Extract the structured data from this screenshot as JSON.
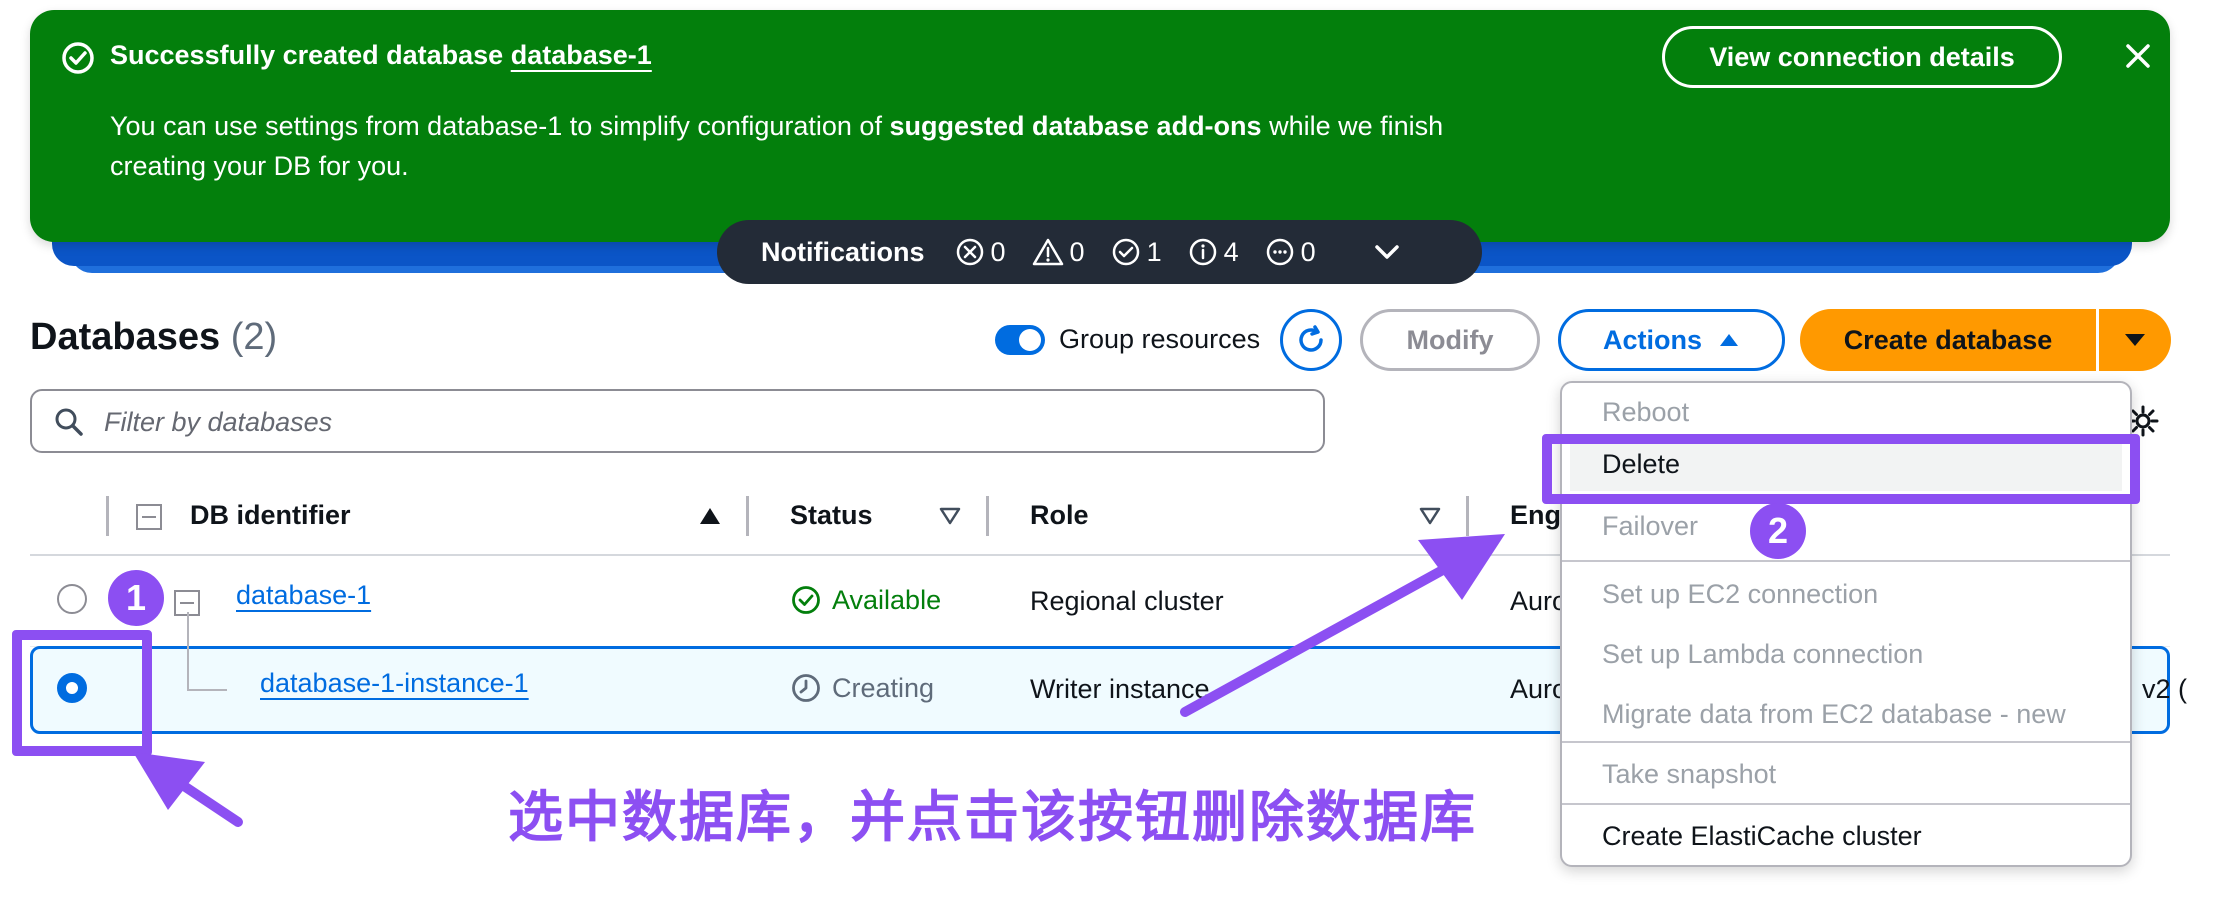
{
  "flash": {
    "title_prefix": "Successfully created database",
    "title_link": "database-1",
    "body_line1_prefix": "You can use settings from database-1 to simplify configuration of",
    "body_bold": "suggested database add-ons",
    "body_line1_suffix": "while we finish",
    "body_line2": "creating your DB for you.",
    "view_button": "View connection details",
    "bg_color": "#037f0c"
  },
  "notifications": {
    "title": "Notifications",
    "errors": "0",
    "warnings": "0",
    "success": "1",
    "info": "4",
    "in_progress": "0"
  },
  "header": {
    "title": "Databases",
    "count": "(2)",
    "group_toggle_label": "Group resources",
    "group_toggle_on": true,
    "modify_label": "Modify",
    "actions_label": "Actions",
    "create_label": "Create database"
  },
  "search": {
    "placeholder": "Filter by databases"
  },
  "table": {
    "columns": [
      "DB identifier",
      "Status",
      "Role",
      "Eng"
    ],
    "rows": [
      {
        "identifier": "database-1",
        "status": "Available",
        "role": "Regional cluster",
        "engine": "Auro",
        "selected": false
      },
      {
        "identifier": "database-1-instance-1",
        "status": "Creating",
        "role": "Writer instance",
        "engine": "Auro",
        "extra": "v2 (",
        "selected": true
      }
    ]
  },
  "actions_menu": {
    "items": [
      {
        "label": "Reboot",
        "enabled": false
      },
      {
        "label": "Delete",
        "enabled": true
      },
      {
        "label": "Failover",
        "enabled": false
      },
      {
        "label": "Set up EC2 connection",
        "enabled": false
      },
      {
        "label": "Set up Lambda connection",
        "enabled": false
      },
      {
        "label": "Migrate data from EC2 database - new",
        "enabled": false
      },
      {
        "label": "Take snapshot",
        "enabled": false
      },
      {
        "label": "Create ElastiCache cluster",
        "enabled": true
      }
    ]
  },
  "annotations": {
    "step1": "1",
    "step2": "2",
    "caption": "选中数据库，并点击该按钮删除数据库",
    "color": "#8c4ff2"
  }
}
